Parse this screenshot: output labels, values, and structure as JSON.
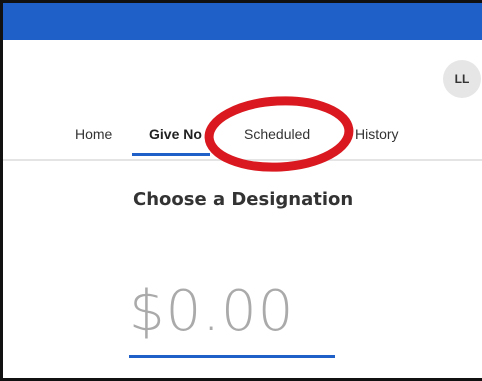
{
  "avatar": {
    "initials": "LL"
  },
  "nav": {
    "tabs": [
      {
        "label": "Home"
      },
      {
        "label": "Give No"
      },
      {
        "label": "Scheduled"
      },
      {
        "label": "History"
      }
    ]
  },
  "main": {
    "heading": "Choose a Designation",
    "amount_placeholder": "$0.00"
  },
  "colors": {
    "brand_blue": "#1f5fc8",
    "annotation_red": "#d9191f"
  }
}
